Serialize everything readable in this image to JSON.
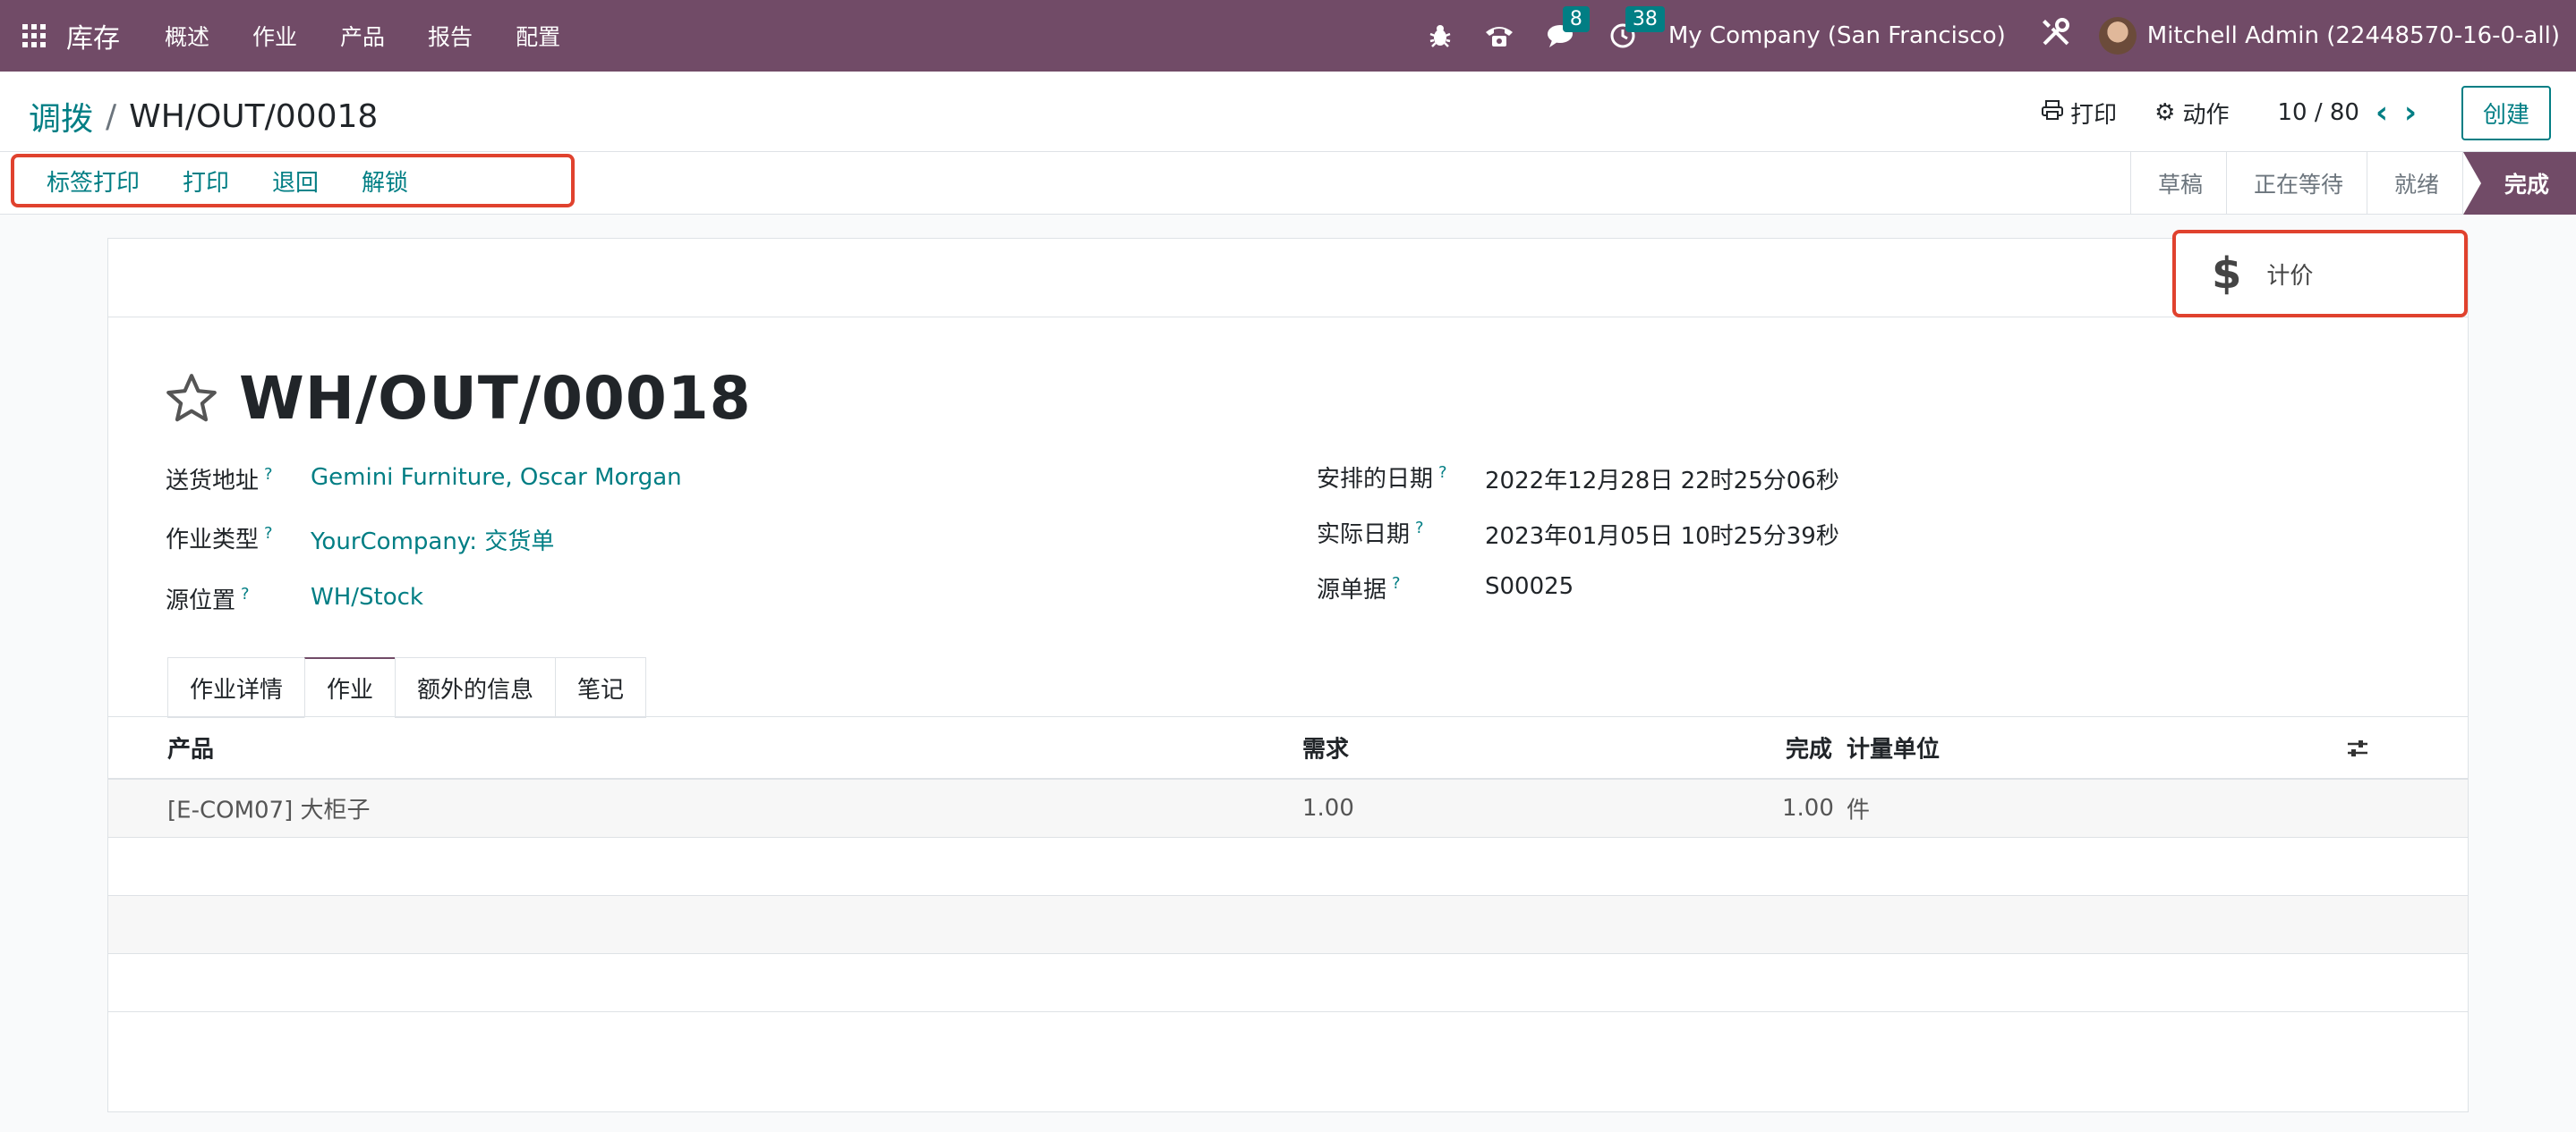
{
  "navbar": {
    "app_name": "库存",
    "menu": [
      "概述",
      "作业",
      "产品",
      "报告",
      "配置"
    ],
    "messages_count": "8",
    "activities_count": "38",
    "company": "My Company (San Francisco)",
    "user": "Mitchell Admin (22448570-16-0-all)",
    "bg_color": "#714b67"
  },
  "breadcrumb": {
    "parent": "调拨",
    "separator": "/",
    "current": "WH/OUT/00018"
  },
  "control": {
    "print_label": "打印",
    "action_label": "动作",
    "pager": "10 / 80",
    "create_label": "创建"
  },
  "statusbar": {
    "actions": [
      "标签打印",
      "打印",
      "退回",
      "解锁"
    ],
    "states": [
      "草稿",
      "正在等待",
      "就绪",
      "完成"
    ],
    "active_state": "完成"
  },
  "stat_button": {
    "icon": "dollar-icon",
    "label": "计价"
  },
  "record": {
    "title": "WH/OUT/00018",
    "fields_left": [
      {
        "label": "送货地址",
        "value": "Gemini Furniture, Oscar Morgan"
      },
      {
        "label": "作业类型",
        "value": "YourCompany: 交货单"
      },
      {
        "label": "源位置",
        "value": "WH/Stock"
      }
    ],
    "fields_right": [
      {
        "label": "安排的日期",
        "value": "2022年12月28日 22时25分06秒"
      },
      {
        "label": "实际日期",
        "value": "2023年01月05日 10时25分39秒"
      },
      {
        "label": "源单据",
        "value": "S00025"
      }
    ],
    "help_mark": "?"
  },
  "tabs": [
    "作业详情",
    "作业",
    "额外的信息",
    "笔记"
  ],
  "active_tab": "作业",
  "table": {
    "headers": {
      "product": "产品",
      "demand": "需求",
      "done": "完成",
      "uom": "计量单位"
    },
    "rows": [
      {
        "product": "[E-COM07] 大柜子",
        "demand": "1.00",
        "done": "1.00",
        "uom": "件"
      }
    ]
  }
}
